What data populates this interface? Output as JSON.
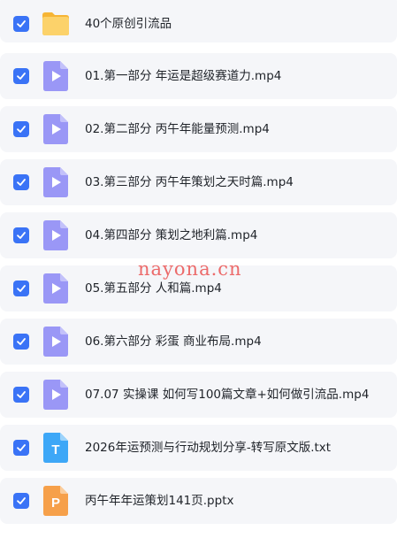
{
  "colors": {
    "checkbox": "#3a73f6",
    "video_icon": "#9a97f6",
    "text_icon": "#3da7f7",
    "ppt_icon": "#f6a04a",
    "folder_icon": "#fbc34a",
    "row_bg": "#f5f6f9",
    "watermark": "#ec6a6a"
  },
  "items": [
    {
      "icon": "folder-icon",
      "checked": true,
      "name": "40个原创引流品"
    },
    {
      "icon": "video-file-icon",
      "checked": true,
      "name": "01.第一部分 年运是超级赛道力.mp4"
    },
    {
      "icon": "video-file-icon",
      "checked": true,
      "name": "02.第二部分 丙午年能量预测.mp4"
    },
    {
      "icon": "video-file-icon",
      "checked": true,
      "name": "03.第三部分 丙午年策划之天时篇.mp4"
    },
    {
      "icon": "video-file-icon",
      "checked": true,
      "name": "04.第四部分 策划之地利篇.mp4"
    },
    {
      "icon": "video-file-icon",
      "checked": true,
      "name": "05.第五部分 人和篇.mp4"
    },
    {
      "icon": "video-file-icon",
      "checked": true,
      "name": "06.第六部分 彩蛋 商业布局.mp4"
    },
    {
      "icon": "video-file-icon",
      "checked": true,
      "name": "07.07 实操课 如何写100篇文章+如何做引流品.mp4"
    },
    {
      "icon": "text-file-icon",
      "checked": true,
      "name": "2026年运预测与行动规划分享-转写原文版.txt"
    },
    {
      "icon": "ppt-file-icon",
      "checked": true,
      "name": "丙午年年运策划141页.pptx"
    }
  ],
  "icon_glyphs": {
    "text": "T",
    "ppt": "P"
  },
  "watermark": "nayona.cn"
}
